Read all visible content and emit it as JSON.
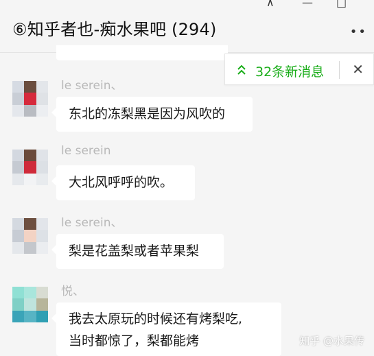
{
  "header": {
    "title": "⑥知乎者也-痴水果吧 (294)",
    "more_icon": "•• "
  },
  "new_messages": {
    "label": "32条新消息",
    "close": "✕",
    "accent": "#1aad19"
  },
  "messages": [
    {
      "sender": "le serein、",
      "lines": [
        "东北的冻梨黑是因为风吹的"
      ]
    },
    {
      "sender": "le serein",
      "lines": [
        "大北风呼呼的吹。"
      ]
    },
    {
      "sender": "le serein、",
      "lines": [
        "梨是花盖梨或者苹果梨"
      ]
    },
    {
      "sender": "悦、",
      "lines": [
        "我去太原玩的时候还有烤梨吃,",
        "当时都惊了，梨都能烤"
      ]
    }
  ],
  "watermark": "知乎 @水果传"
}
